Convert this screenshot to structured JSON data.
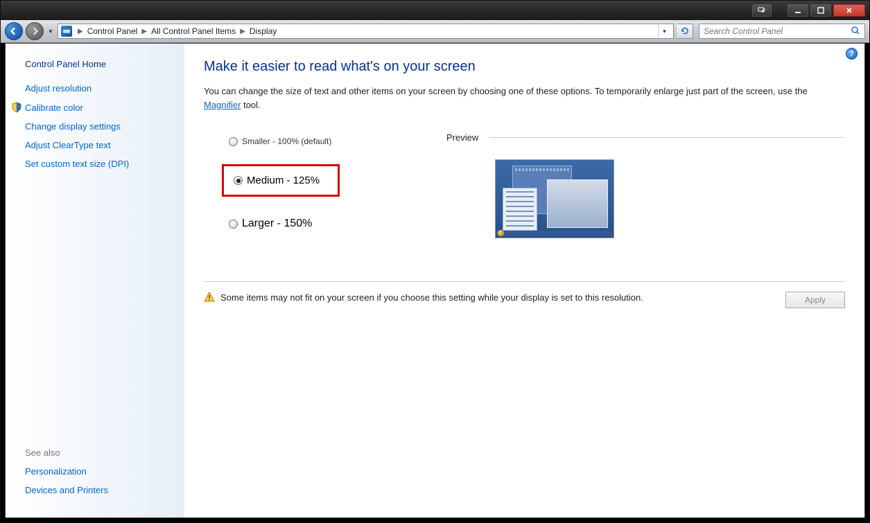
{
  "titlebar": {
    "switch_tip": "Switch",
    "minimize_tip": "Minimize",
    "maximize_tip": "Maximize",
    "close_tip": "Close"
  },
  "nav": {
    "breadcrumb": [
      "Control Panel",
      "All Control Panel Items",
      "Display"
    ],
    "search_placeholder": "Search Control Panel"
  },
  "sidebar": {
    "home": "Control Panel Home",
    "links": [
      "Adjust resolution",
      "Calibrate color",
      "Change display settings",
      "Adjust ClearType text",
      "Set custom text size (DPI)"
    ],
    "see_also_label": "See also",
    "see_also": [
      "Personalization",
      "Devices and Printers"
    ]
  },
  "main": {
    "title": "Make it easier to read what's on your screen",
    "desc_prefix": "You can change the size of text and other items on your screen by choosing one of these options. To temporarily enlarge just part of the screen, use the ",
    "desc_link": "Magnifier",
    "desc_suffix": " tool.",
    "options": {
      "small": "Smaller - 100% (default)",
      "medium": "Medium - 125%",
      "large": "Larger - 150%",
      "selected": "medium"
    },
    "preview_label": "Preview",
    "warning": "Some items may not fit on your screen if you choose this setting while your display is set to this resolution.",
    "apply_label": "Apply"
  }
}
